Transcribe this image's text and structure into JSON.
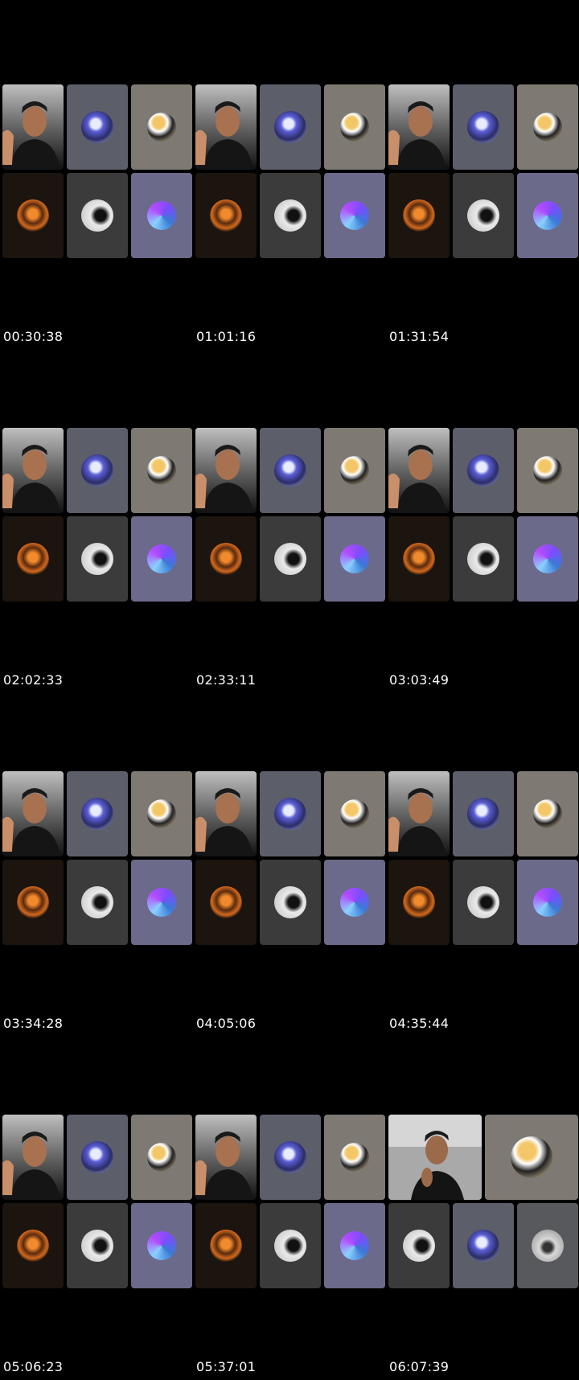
{
  "frames": [
    {
      "timestamp": "00:30:38",
      "layout": "grid6"
    },
    {
      "timestamp": "01:01:16",
      "layout": "grid6"
    },
    {
      "timestamp": "01:31:54",
      "layout": "grid6"
    },
    {
      "timestamp": "02:02:33",
      "layout": "grid6"
    },
    {
      "timestamp": "02:33:11",
      "layout": "grid6"
    },
    {
      "timestamp": "03:03:49",
      "layout": "grid6"
    },
    {
      "timestamp": "03:34:28",
      "layout": "grid6"
    },
    {
      "timestamp": "04:05:06",
      "layout": "grid6"
    },
    {
      "timestamp": "04:35:44",
      "layout": "grid6"
    },
    {
      "timestamp": "05:06:23",
      "layout": "grid6"
    },
    {
      "timestamp": "05:37:01",
      "layout": "grid6"
    },
    {
      "timestamp": "06:07:39",
      "layout": "grid5"
    }
  ],
  "participants": {
    "camera": {
      "icon": "camera-feed-person",
      "bg": "#6b6b6b"
    },
    "p2": {
      "icon": "avatar-anime-blue",
      "bg": "#5c5e6a"
    },
    "p3": {
      "icon": "avatar-anime-blonde",
      "bg": "#7e7a73"
    },
    "p4": {
      "icon": "avatar-orange-emblem",
      "bg": "#1c140e"
    },
    "p5": {
      "icon": "avatar-bw-character",
      "bg": "#3a3b3a"
    },
    "p6": {
      "icon": "avatar-anime-purple",
      "bg": "#6c6a8a"
    },
    "p7": {
      "icon": "avatar-grey-car",
      "bg": "#58595c"
    }
  }
}
